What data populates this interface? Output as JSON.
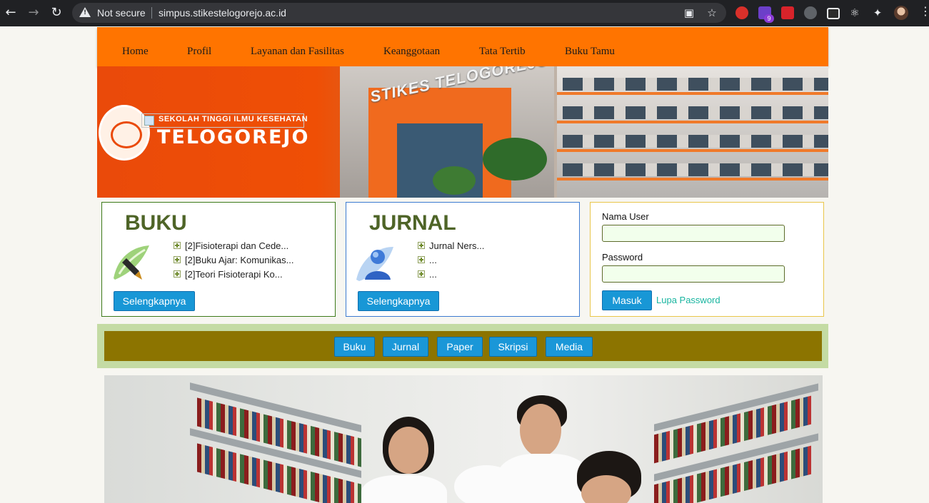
{
  "browser": {
    "security_label": "Not secure",
    "url": "simpus.stikestelogorejo.ac.id",
    "extension_badge": "9"
  },
  "nav": {
    "items": [
      "Home",
      "Profil",
      "Layanan dan Fasilitas",
      "Keanggotaan",
      "Tata Tertib",
      "Buku Tamu"
    ]
  },
  "banner": {
    "school_small": "SEKOLAH TINGGI ILMU KESEHATAN",
    "school_big": "TELOGOREJO",
    "building_sign": "STIKES TELOGOREJO"
  },
  "buku": {
    "title": "BUKU",
    "items": [
      "[2]Fisioterapi dan Cede...",
      "[2]Buku Ajar: Komunikas...",
      "[2]Teori Fisioterapi Ko..."
    ],
    "more_label": "Selengkapnya"
  },
  "jurnal": {
    "title": "JURNAL",
    "items": [
      "Jurnal Ners...",
      "...",
      "..."
    ],
    "more_label": "Selengkapnya"
  },
  "login": {
    "username_label": "Nama User",
    "password_label": "Password",
    "submit_label": "Masuk",
    "forgot_label": "Lupa Password"
  },
  "categories": [
    "Buku",
    "Jurnal",
    "Paper",
    "Skripsi",
    "Media"
  ],
  "colors": {
    "nav_bg": "#ff7400",
    "accent_green": "#4e6427",
    "button_blue": "#1897d6",
    "category_bar": "#8c7400",
    "category_outer": "#c4dba4"
  }
}
